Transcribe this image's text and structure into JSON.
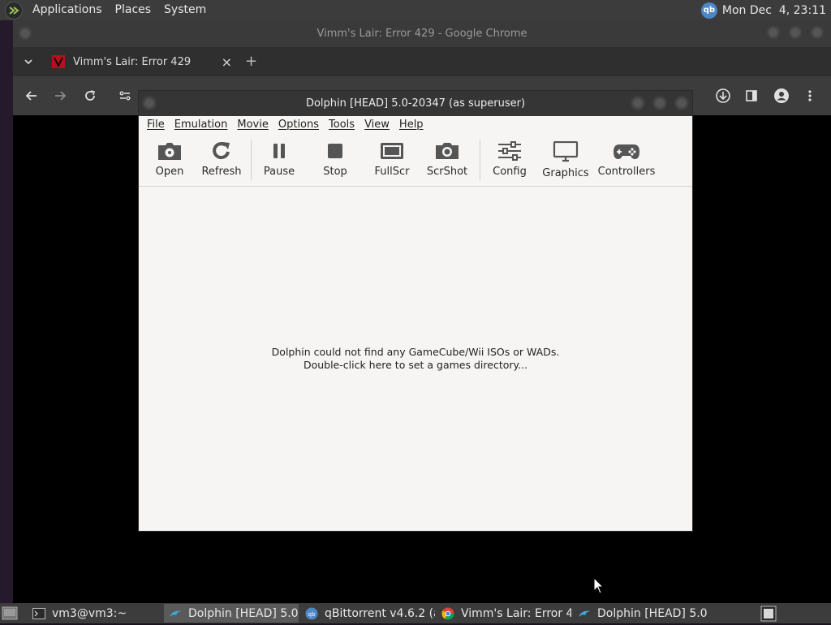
{
  "top_panel": {
    "menus": [
      "Applications",
      "Places",
      "System"
    ],
    "tray_qb_label": "qb",
    "clock": "Mon Dec  4, 23:11"
  },
  "chrome": {
    "title": "Vimm's Lair: Error 429 - Google Chrome",
    "tab_title": "Vimm's Lair: Error 429",
    "tab_close": "×",
    "new_tab": "+"
  },
  "dolphin": {
    "title": "Dolphin [HEAD] 5.0-20347 (as superuser)",
    "menu": [
      "File",
      "Emulation",
      "Movie",
      "Options",
      "Tools",
      "View",
      "Help"
    ],
    "toolbar": {
      "open": "Open",
      "refresh": "Refresh",
      "pause": "Pause",
      "stop": "Stop",
      "fullscr": "FullScr",
      "scrshot": "ScrShot",
      "config": "Config",
      "graphics": "Graphics",
      "controllers": "Controllers"
    },
    "empty_line1": "Dolphin could not find any GameCube/Wii ISOs or WADs.",
    "empty_line2": "Double-click here to set a games directory..."
  },
  "taskbar": {
    "items": [
      {
        "label": "vm3@vm3:~",
        "icon": "terminal-icon"
      },
      {
        "label": "Dolphin [HEAD] 5.0...",
        "icon": "dolphin-icon",
        "active": true
      },
      {
        "label": "qBittorrent v4.6.2 (a...",
        "icon": "qbittorrent-icon"
      },
      {
        "label": "Vimm's Lair: Error 4...",
        "icon": "chrome-icon"
      },
      {
        "label": "Dolphin [HEAD] 5.0...",
        "icon": "dolphin-icon"
      }
    ]
  },
  "colors": {
    "panel": "#3c3c3c",
    "dolphin_bg": "#f6f5f4",
    "chrome_toolbar": "#3c3c3c",
    "vimm_red": "#b3121c"
  }
}
